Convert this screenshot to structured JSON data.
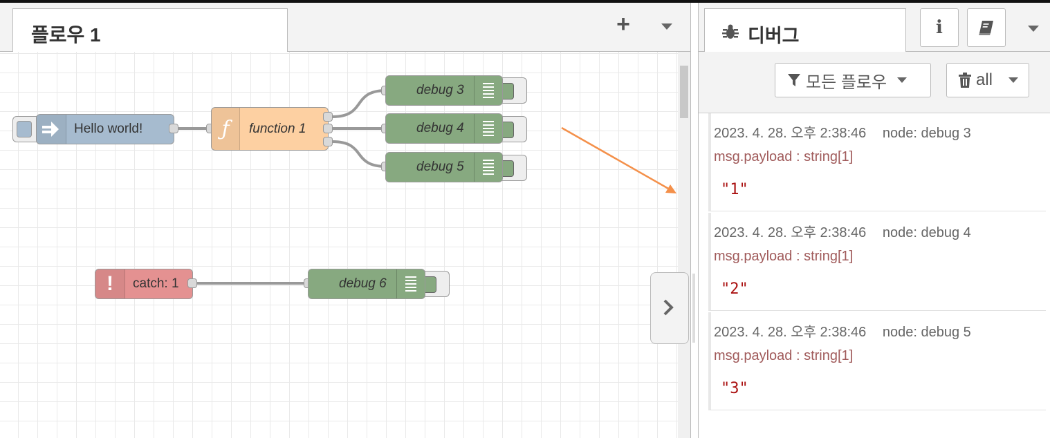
{
  "workspace": {
    "tab_label": "플로우 1",
    "add_tab_icon": "plus-icon",
    "tab_menu_icon": "caret-down-icon"
  },
  "nodes": {
    "inject": {
      "label": "Hello world!",
      "color": "#a6bbcf",
      "icon": "arrow-right-icon"
    },
    "function": {
      "label": "function 1",
      "color": "#fdd0a2",
      "icon": "function-icon"
    },
    "debug3": {
      "label": "debug 3",
      "color": "#87a980"
    },
    "debug4": {
      "label": "debug 4",
      "color": "#87a980"
    },
    "debug5": {
      "label": "debug 5",
      "color": "#87a980"
    },
    "catch": {
      "label": "catch: 1",
      "color": "#e49191",
      "icon": "exclamation-icon"
    },
    "debug6": {
      "label": "debug 6",
      "color": "#87a980"
    }
  },
  "sidebar": {
    "tab_label": "디버그",
    "tab_icon": "bug-icon",
    "info_icon": "info-icon",
    "help_icon": "book-icon",
    "filter_label": "모든 플로우",
    "clear_label": "all",
    "messages": [
      {
        "timestamp": "2023. 4. 28. 오후 2:38:46",
        "node": "node: debug 3",
        "path": "msg.payload : string[1]",
        "value": "\"1\""
      },
      {
        "timestamp": "2023. 4. 28. 오후 2:38:46",
        "node": "node: debug 4",
        "path": "msg.payload : string[1]",
        "value": "\"2\""
      },
      {
        "timestamp": "2023. 4. 28. 오후 2:38:46",
        "node": "node: debug 5",
        "path": "msg.payload : string[1]",
        "value": "\"3\""
      }
    ]
  },
  "colors": {
    "annotation_arrow": "#f4904a",
    "wire": "#999999"
  }
}
